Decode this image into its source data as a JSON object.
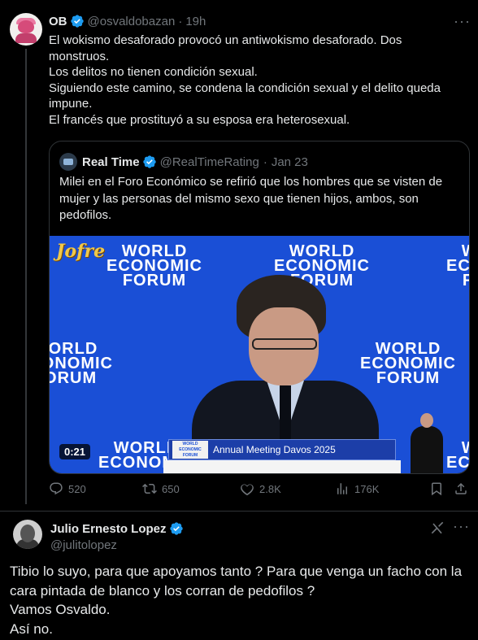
{
  "tweet1": {
    "author_name": "OB",
    "author_handle": "@osvaldobazan",
    "separator": "·",
    "time": "19h",
    "text_lines": [
      "El wokismo desaforado provocó un antiwokismo desaforado. Dos monstruos.",
      "Los delitos no tienen condición sexual.",
      "Siguiendo este camino, se condena la condición sexual y el delito queda impune.",
      "El francés que prostituyó a su esposa era heterosexual."
    ],
    "quote": {
      "author_name": "Real Time",
      "author_handle": "@RealTimeRating",
      "separator": "·",
      "date": "Jan 23",
      "text": "Milei en el Foro Económico se refirió que los hombres que se visten de mujer y las personas del mismo sexo que tienen hijos, ambos, son pedofilos.",
      "video": {
        "duration": "0:21",
        "watermark": "Jofre",
        "logo_lines": [
          "WORLD",
          "ECONOMIC",
          "FORUM"
        ],
        "podium_logo_lines": [
          "WORLD",
          "ECONOMIC",
          "FORUM"
        ],
        "podium_text": "Annual Meeting Davos 2025"
      }
    },
    "actions": {
      "replies": "520",
      "reposts": "650",
      "likes": "2.8K",
      "views": "176K"
    }
  },
  "tweet2": {
    "author_name": "Julio Ernesto Lopez",
    "author_handle": "@julitolopez",
    "text_lines": [
      "Tibio lo suyo, para que apoyamos tanto ? Para que venga un facho con la cara pintada de blanco y los corran de pedofilos ?",
      "Vamos Osvaldo.",
      "Así no."
    ]
  },
  "colors": {
    "background": "#000000",
    "text": "#e7e9ea",
    "muted": "#71767b",
    "verified": "#1d9bf0",
    "border": "#2f3336",
    "video_bg": "#1a4fd6"
  }
}
